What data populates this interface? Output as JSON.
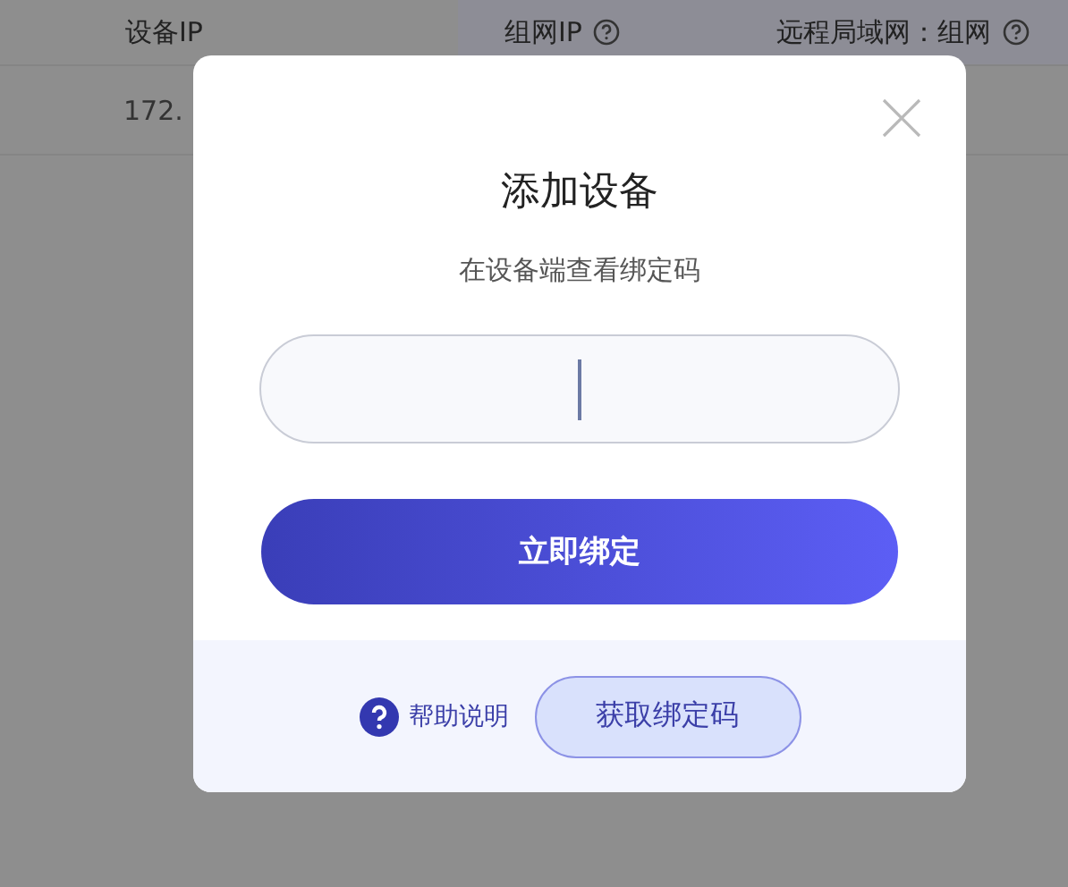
{
  "table": {
    "columns": [
      {
        "label": "设备IP",
        "help": false
      },
      {
        "label": "组网IP",
        "help": true
      },
      {
        "label": "远程局域网：组网",
        "help": true
      }
    ],
    "rows": [
      [
        "172."
      ]
    ]
  },
  "dialog": {
    "title": "添加设备",
    "subtitle": "在设备端查看绑定码",
    "code_field": {
      "focused": true
    },
    "primary_button": "立即绑定",
    "help_link": "帮助说明",
    "secondary_button": "获取绑定码"
  }
}
